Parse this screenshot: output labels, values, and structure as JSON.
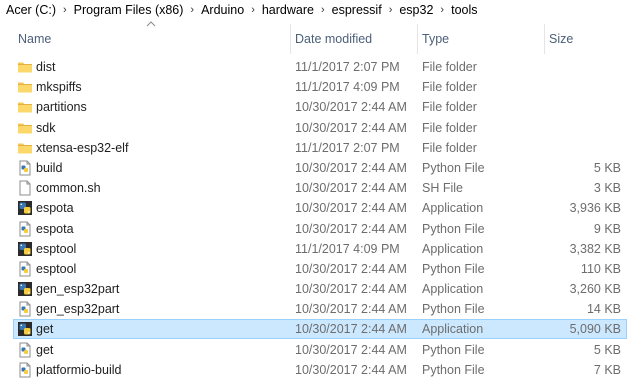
{
  "breadcrumb": [
    "Acer (C:)",
    "Program Files (x86)",
    "Arduino",
    "hardware",
    "espressif",
    "esp32",
    "tools"
  ],
  "breadcrumb_separator": "›",
  "columns": {
    "name": "Name",
    "date": "Date modified",
    "type": "Type",
    "size": "Size"
  },
  "files": [
    {
      "name": "dist",
      "date": "11/1/2017 2:07 PM",
      "type": "File folder",
      "size": "",
      "icon": "folder-icon"
    },
    {
      "name": "mkspiffs",
      "date": "11/1/2017 4:09 PM",
      "type": "File folder",
      "size": "",
      "icon": "folder-icon"
    },
    {
      "name": "partitions",
      "date": "10/30/2017 2:44 AM",
      "type": "File folder",
      "size": "",
      "icon": "folder-icon"
    },
    {
      "name": "sdk",
      "date": "10/30/2017 2:44 AM",
      "type": "File folder",
      "size": "",
      "icon": "folder-icon"
    },
    {
      "name": "xtensa-esp32-elf",
      "date": "11/1/2017 2:07 PM",
      "type": "File folder",
      "size": "",
      "icon": "folder-icon"
    },
    {
      "name": "build",
      "date": "10/30/2017 2:44 AM",
      "type": "Python File",
      "size": "5 KB",
      "icon": "python-file-icon"
    },
    {
      "name": "common.sh",
      "date": "10/30/2017 2:44 AM",
      "type": "SH File",
      "size": "3 KB",
      "icon": "blank-file-icon"
    },
    {
      "name": "espota",
      "date": "10/30/2017 2:44 AM",
      "type": "Application",
      "size": "3,936 KB",
      "icon": "python-app-icon"
    },
    {
      "name": "espota",
      "date": "10/30/2017 2:44 AM",
      "type": "Python File",
      "size": "9 KB",
      "icon": "python-file-icon"
    },
    {
      "name": "esptool",
      "date": "11/1/2017 4:09 PM",
      "type": "Application",
      "size": "3,382 KB",
      "icon": "python-app-icon"
    },
    {
      "name": "esptool",
      "date": "10/30/2017 2:44 AM",
      "type": "Python File",
      "size": "110 KB",
      "icon": "python-file-icon"
    },
    {
      "name": "gen_esp32part",
      "date": "10/30/2017 2:44 AM",
      "type": "Application",
      "size": "3,260 KB",
      "icon": "python-app-icon"
    },
    {
      "name": "gen_esp32part",
      "date": "10/30/2017 2:44 AM",
      "type": "Python File",
      "size": "14 KB",
      "icon": "python-file-icon"
    },
    {
      "name": "get",
      "date": "10/30/2017 2:44 AM",
      "type": "Application",
      "size": "5,090 KB",
      "icon": "python-app-icon",
      "selected": true
    },
    {
      "name": "get",
      "date": "10/30/2017 2:44 AM",
      "type": "Python File",
      "size": "5 KB",
      "icon": "python-file-icon"
    },
    {
      "name": "platformio-build",
      "date": "10/30/2017 2:44 AM",
      "type": "Python File",
      "size": "7 KB",
      "icon": "python-file-icon"
    }
  ],
  "colors": {
    "selection_fill": "#cce8ff",
    "selection_border": "#99d1ff",
    "folder": "#f6c85a",
    "header_text": "#4c607a"
  }
}
